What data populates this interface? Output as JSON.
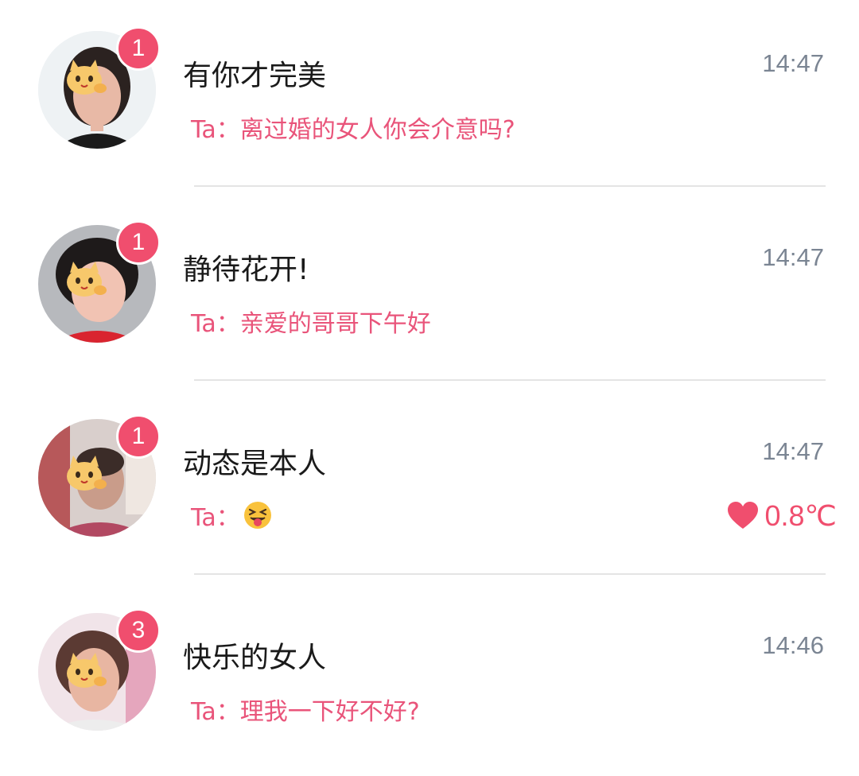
{
  "chats": [
    {
      "name": "有你才完美",
      "time": "14:47",
      "preview_prefix": "Ta：",
      "preview": "离过婚的女人你会介意吗?",
      "unread": "1"
    },
    {
      "name": "静待花开!",
      "time": "14:47",
      "preview_prefix": "Ta：",
      "preview": "亲爱的哥哥下午好",
      "unread": "1"
    },
    {
      "name": "动态是本人",
      "time": "14:47",
      "preview_prefix": "Ta：",
      "preview": "",
      "preview_emoji": "squinting-tongue-face-emoji",
      "unread": "1",
      "intimacy": "0.8℃",
      "intimacy_icon": "heart-icon"
    },
    {
      "name": "快乐的女人",
      "time": "14:46",
      "preview_prefix": "Ta：",
      "preview": "理我一下好不好?",
      "unread": "3"
    }
  ],
  "colors": {
    "accent_pink": "#e9547a",
    "badge_red": "#f04e6e",
    "time_gray": "#7b8593",
    "divider": "#e4e4e4"
  }
}
